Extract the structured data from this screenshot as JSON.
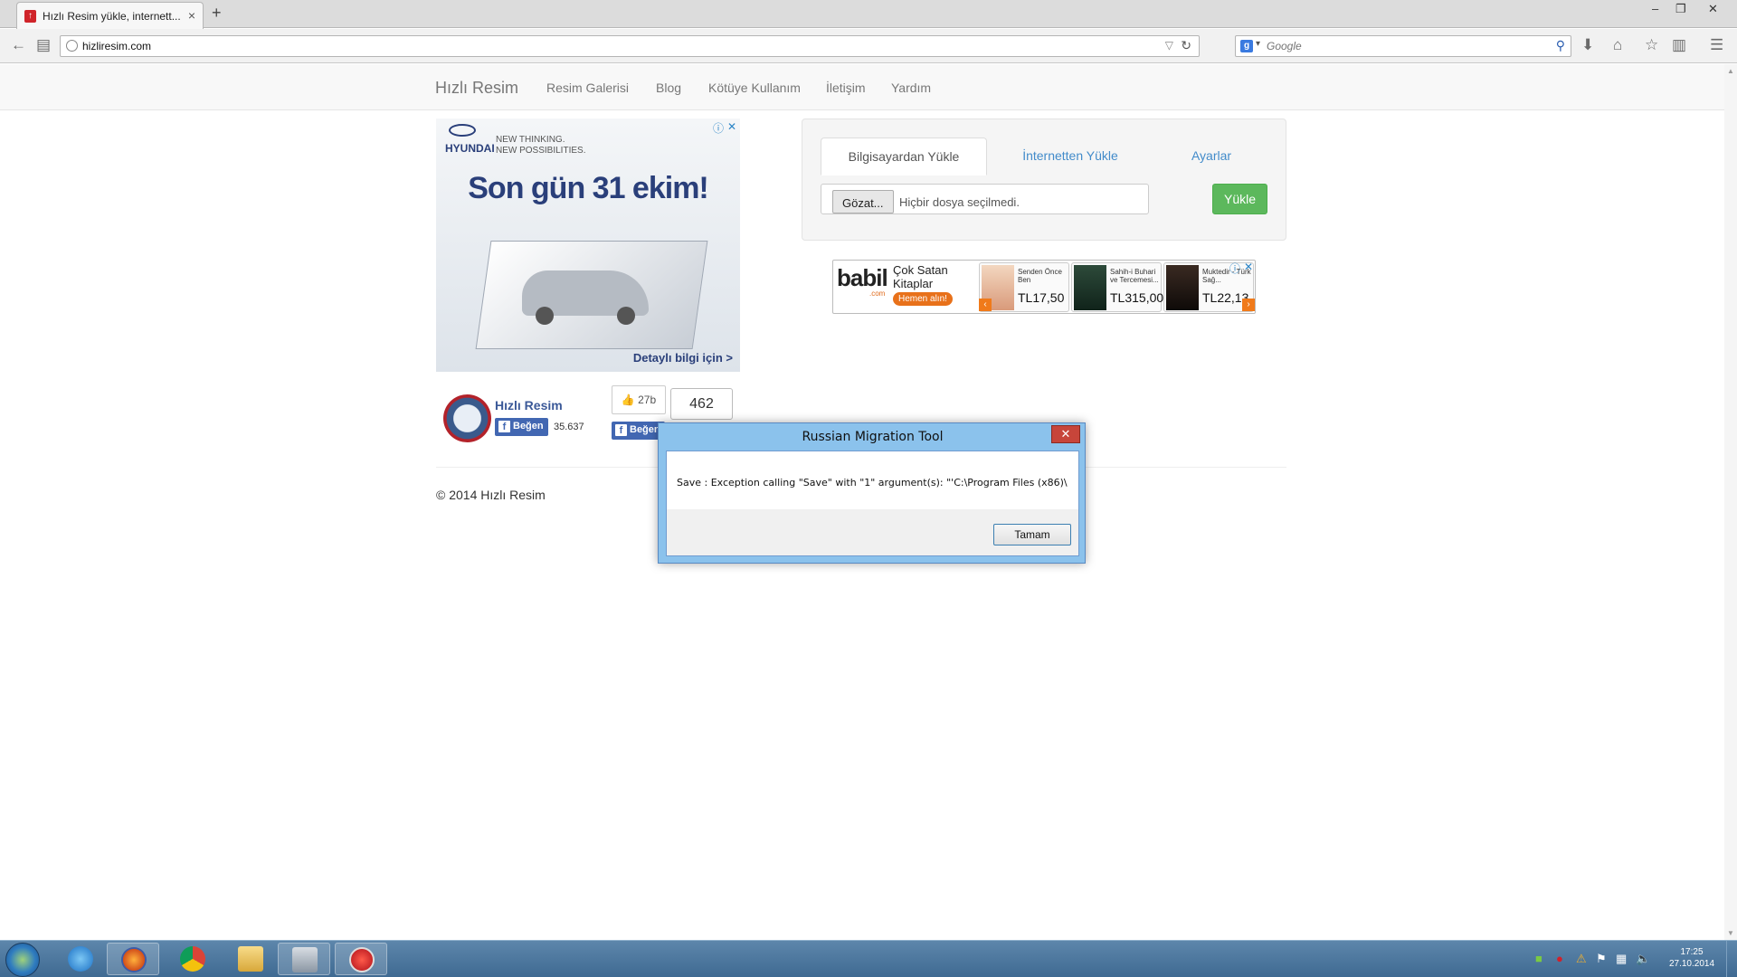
{
  "browser": {
    "tab_title": "Hızlı Resim yükle, internett...",
    "tab_close": "×",
    "new_tab": "+",
    "url": "hizliresim.com",
    "search_placeholder": "Google",
    "win_minimize": "–",
    "win_restore": "❐",
    "win_close": "✕"
  },
  "site": {
    "brand": "Hızlı Resim",
    "nav": [
      "Resim Galerisi",
      "Blog",
      "Kötüye Kullanım",
      "İletişim",
      "Yardım"
    ]
  },
  "ad_hyundai": {
    "logo": "HYUNDAI",
    "tagline_1": "NEW THINKING.",
    "tagline_2": "NEW POSSIBILITIES.",
    "headline": "Son gün 31 ekim!",
    "cta": "Detaylı bilgi için >"
  },
  "ad_babil": {
    "logo": "babil",
    "domain": ".com",
    "title": "Çok Satan Kitaplar",
    "cta": "Hemen alın!",
    "books": [
      {
        "title": "Senden Önce Ben",
        "price": "TL17,50"
      },
      {
        "title": "Sahih-i Buhari ve Tercemesi...",
        "price": "TL315,00"
      },
      {
        "title": "Muktedir - Türk Sağ...",
        "price": "TL22,13"
      }
    ]
  },
  "upload": {
    "tabs": [
      "Bilgisayardan Yükle",
      "İnternetten Yükle",
      "Ayarlar"
    ],
    "browse_label": "Gözat...",
    "file_status": "Hiçbir dosya seçilmedi.",
    "upload_button": "Yükle"
  },
  "social": {
    "page_name": "Hızlı Resim",
    "like_label": "Beğen",
    "like_count": "35.637",
    "thumb_count": "27b",
    "share_count": "462",
    "like_label_2": "Beğen"
  },
  "footer": {
    "text": "© 2014 Hızlı Resim"
  },
  "dialog": {
    "title": "Russian Migration Tool",
    "close": "✕",
    "message": "Save : Exception calling \"Save\" with \"1\" argument(s): \"'C:\\Program Files (x86)\\",
    "ok_button": "Tamam"
  },
  "taskbar": {
    "time": "17:25",
    "date": "27.10.2014"
  },
  "colors": {
    "upload_green": "#5cb85c",
    "link_blue": "#428bca",
    "facebook_blue": "#4267b2",
    "dialog_title_bar": "#8bc2ec",
    "dialog_close_red": "#c7453a"
  }
}
